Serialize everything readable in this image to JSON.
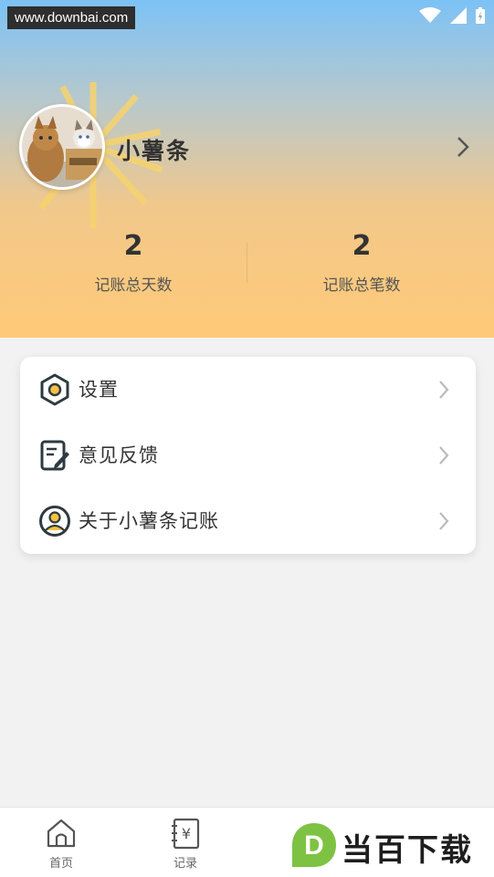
{
  "status_bar": {
    "watermark_text": "www.downbai.com",
    "icons": [
      "wifi-icon",
      "signal-icon",
      "battery-icon"
    ]
  },
  "profile": {
    "username": "小薯条",
    "avatar_icon": "cat-photo-avatar"
  },
  "stats": [
    {
      "value": "2",
      "label": "记账总天数"
    },
    {
      "value": "2",
      "label": "记账总笔数"
    }
  ],
  "menu": [
    {
      "label": "设置",
      "icon": "settings-hexagon-icon"
    },
    {
      "label": "意见反馈",
      "icon": "feedback-edit-icon"
    },
    {
      "label": "关于小薯条记账",
      "icon": "about-user-icon"
    }
  ],
  "tabbar": {
    "tabs": [
      {
        "label": "首页",
        "icon": "home-icon"
      },
      {
        "label": "记录",
        "icon": "ledger-yen-icon"
      }
    ]
  },
  "brand_watermark": {
    "letter": "D",
    "text": "当百下载"
  },
  "colors": {
    "header_top": "#7cc2f6",
    "header_bottom": "#ffca78",
    "accent_yellow": "#f5c242",
    "icon_dark": "#2e3a40"
  }
}
